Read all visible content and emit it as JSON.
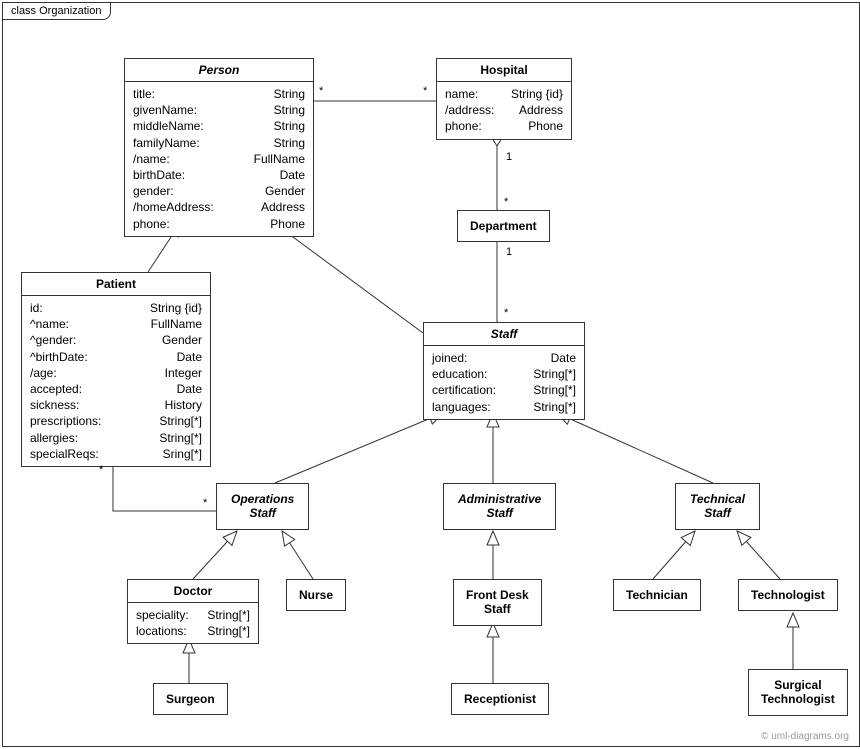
{
  "frame": {
    "title": "class Organization"
  },
  "watermark": "© uml-diagrams.org",
  "classes": {
    "person": {
      "name": "Person",
      "attrs": [
        {
          "n": "title:",
          "t": "String"
        },
        {
          "n": "givenName:",
          "t": "String"
        },
        {
          "n": "middleName:",
          "t": "String"
        },
        {
          "n": "familyName:",
          "t": "String"
        },
        {
          "n": "/name:",
          "t": "FullName"
        },
        {
          "n": "birthDate:",
          "t": "Date"
        },
        {
          "n": "gender:",
          "t": "Gender"
        },
        {
          "n": "/homeAddress:",
          "t": "Address"
        },
        {
          "n": "phone:",
          "t": "Phone"
        }
      ]
    },
    "hospital": {
      "name": "Hospital",
      "attrs": [
        {
          "n": "name:",
          "t": "String {id}"
        },
        {
          "n": "/address:",
          "t": "Address"
        },
        {
          "n": "phone:",
          "t": "Phone"
        }
      ]
    },
    "department": {
      "name": "Department"
    },
    "patient": {
      "name": "Patient",
      "attrs": [
        {
          "n": "id:",
          "t": "String {id}"
        },
        {
          "n": "^name:",
          "t": "FullName"
        },
        {
          "n": "^gender:",
          "t": "Gender"
        },
        {
          "n": "^birthDate:",
          "t": "Date"
        },
        {
          "n": "/age:",
          "t": "Integer"
        },
        {
          "n": "accepted:",
          "t": "Date"
        },
        {
          "n": "sickness:",
          "t": "History"
        },
        {
          "n": "prescriptions:",
          "t": "String[*]"
        },
        {
          "n": "allergies:",
          "t": "String[*]"
        },
        {
          "n": "specialReqs:",
          "t": "Sring[*]"
        }
      ]
    },
    "staff": {
      "name": "Staff",
      "attrs": [
        {
          "n": "joined:",
          "t": "Date"
        },
        {
          "n": "education:",
          "t": "String[*]"
        },
        {
          "n": "certification:",
          "t": "String[*]"
        },
        {
          "n": "languages:",
          "t": "String[*]"
        }
      ]
    },
    "opsStaff": {
      "name": "Operations\nStaff"
    },
    "adminStaff": {
      "name": "Administrative\nStaff"
    },
    "techStaff": {
      "name": "Technical\nStaff"
    },
    "doctor": {
      "name": "Doctor",
      "attrs": [
        {
          "n": "speciality:",
          "t": "String[*]"
        },
        {
          "n": "locations:",
          "t": "String[*]"
        }
      ]
    },
    "nurse": {
      "name": "Nurse"
    },
    "frontDesk": {
      "name": "Front Desk\nStaff"
    },
    "technician": {
      "name": "Technician"
    },
    "technologist": {
      "name": "Technologist"
    },
    "surgeon": {
      "name": "Surgeon"
    },
    "receptionist": {
      "name": "Receptionist"
    },
    "surgTech": {
      "name": "Surgical\nTechnologist"
    }
  },
  "mult": {
    "ph_left": "*",
    "ph_right": "*",
    "hd_top": "1",
    "hd_bot": "*",
    "ds_top": "1",
    "ds_bot": "*",
    "po_pat": "*",
    "po_ops": "*"
  }
}
